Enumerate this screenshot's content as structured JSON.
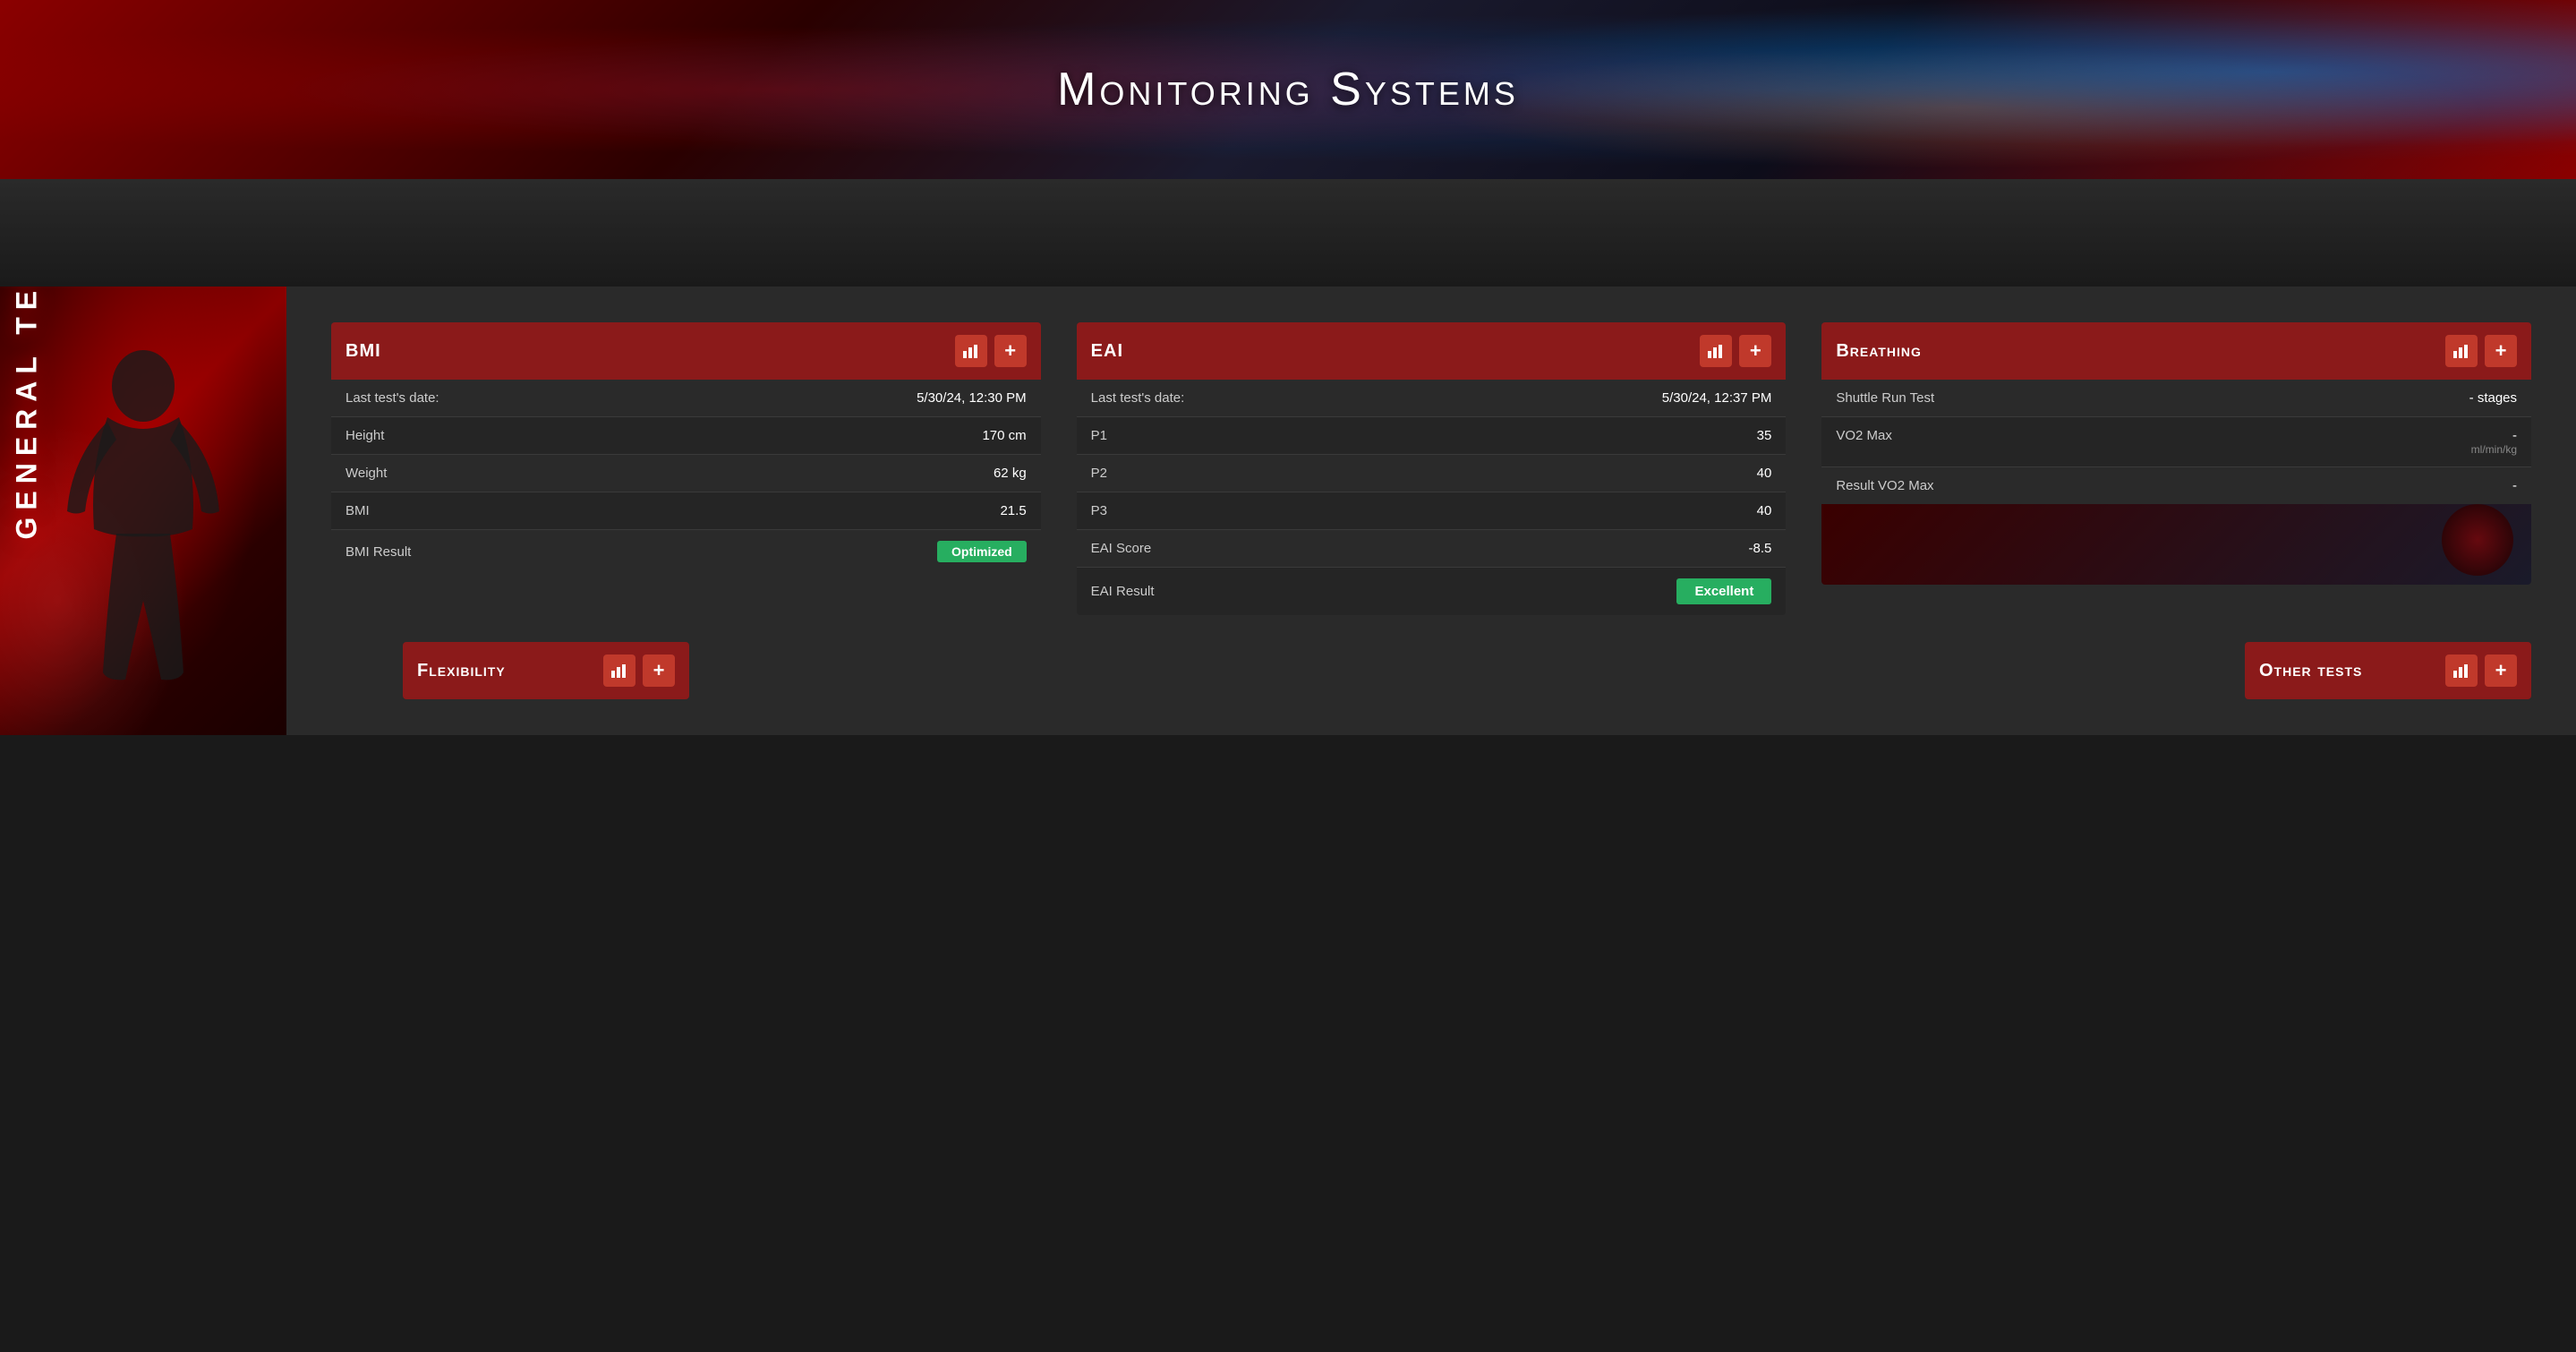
{
  "header": {
    "title": "Monitoring Systems"
  },
  "sidebar": {
    "label": "GENERAL TESTS"
  },
  "bmi_card": {
    "title": "BMI",
    "rows": [
      {
        "label": "Last test's date:",
        "value": "5/30/24, 12:30 PM"
      },
      {
        "label": "Height",
        "value": "170 cm"
      },
      {
        "label": "Weight",
        "value": "62 kg"
      },
      {
        "label": "BMI",
        "value": "21.5"
      },
      {
        "label": "BMI Result",
        "value": "Optimized",
        "badge": true,
        "badge_color": "#27ae60"
      }
    ],
    "btn_chart_label": "📊",
    "btn_add_label": "+"
  },
  "eai_card": {
    "title": "EAI",
    "rows": [
      {
        "label": "Last test's date:",
        "value": "5/30/24, 12:37 PM"
      },
      {
        "label": "P1",
        "value": "35"
      },
      {
        "label": "P2",
        "value": "40"
      },
      {
        "label": "P3",
        "value": "40"
      },
      {
        "label": "EAI Score",
        "value": "-8.5"
      },
      {
        "label": "EAI Result",
        "value": "Excellent",
        "badge": true,
        "badge_color": "#27ae60"
      }
    ],
    "btn_chart_label": "📊",
    "btn_add_label": "+"
  },
  "breathing_card": {
    "title": "Breathing",
    "rows": [
      {
        "label": "Shuttle Run Test",
        "value": "- stages"
      },
      {
        "label": "VO2 Max",
        "value": "-",
        "subvalue": "ml/min/kg"
      },
      {
        "label": "Result VO2 Max",
        "value": "-"
      }
    ],
    "btn_chart_label": "📊",
    "btn_add_label": "+"
  },
  "flexibility_card": {
    "title": "Flexibility",
    "btn_chart_label": "📊",
    "btn_add_label": "+"
  },
  "other_tests_card": {
    "title": "Other tests",
    "btn_chart_label": "📊",
    "btn_add_label": "+"
  },
  "icons": {
    "chart": "▦",
    "plus": "+"
  }
}
